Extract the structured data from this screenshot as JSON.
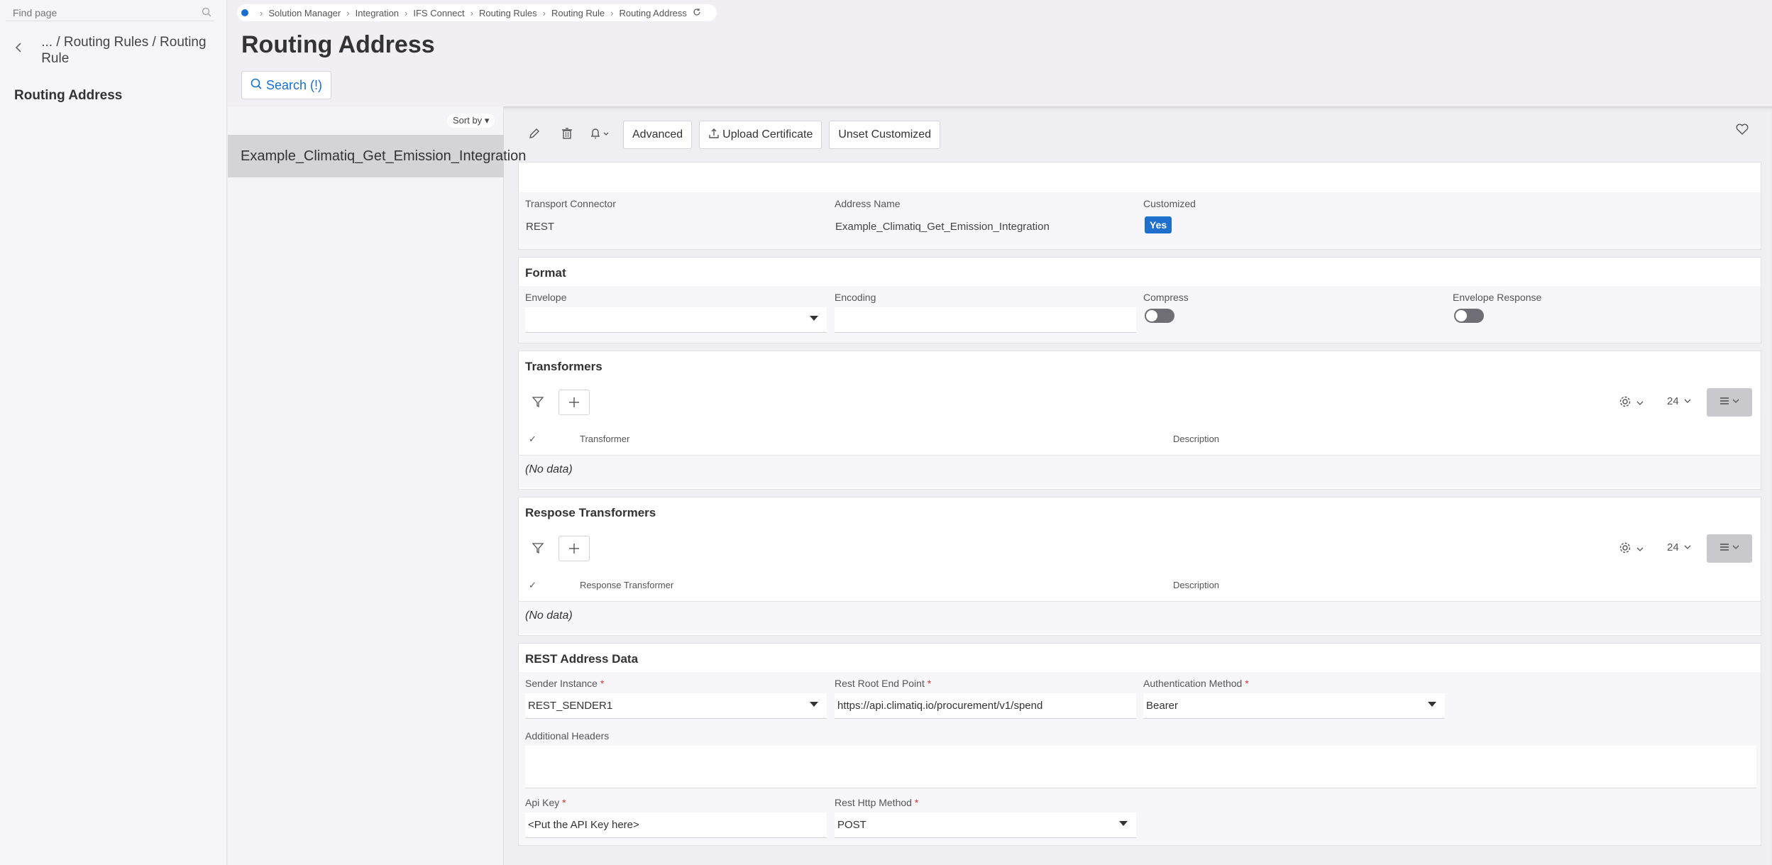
{
  "nav": {
    "find_placeholder": "Find page",
    "back_label": "... / Routing Rules / Routing Rule",
    "current": "Routing Address"
  },
  "breadcrumb": [
    "Solution Manager",
    "Integration",
    "IFS Connect",
    "Routing Rules",
    "Routing Rule",
    "Routing Address"
  ],
  "page": {
    "title": "Routing Address",
    "search_label": "Search (!)"
  },
  "list": {
    "sort_label": "Sort by",
    "items": [
      "Example_Climatiq_Get_Emission_Integration"
    ]
  },
  "toolbar": {
    "advanced": "Advanced",
    "upload_certificate": "Upload Certificate",
    "unset_customized": "Unset Customized"
  },
  "header_card": {
    "transport_connector_label": "Transport Connector",
    "transport_connector_value": "REST",
    "address_name_label": "Address Name",
    "address_name_value": "Example_Climatiq_Get_Emission_Integration",
    "customized_label": "Customized",
    "customized_value": "Yes"
  },
  "format": {
    "title": "Format",
    "envelope_label": "Envelope",
    "envelope_value": "",
    "encoding_label": "Encoding",
    "encoding_value": "",
    "compress_label": "Compress",
    "compress_on": false,
    "envelope_response_label": "Envelope Response",
    "envelope_response_on": false
  },
  "transformers": {
    "title": "Transformers",
    "page_size": "24",
    "col_transformer": "Transformer",
    "col_description": "Description",
    "empty": "(No data)"
  },
  "response_transformers": {
    "title": "Respose Transformers",
    "page_size": "24",
    "col_transformer": "Response Transformer",
    "col_description": "Description",
    "empty": "(No data)"
  },
  "rest": {
    "title": "REST Address Data",
    "sender_instance_label": "Sender Instance",
    "sender_instance_value": "REST_SENDER1",
    "root_endpoint_label": "Rest Root End Point",
    "root_endpoint_value": "https://api.climatiq.io/procurement/v1/spend",
    "auth_method_label": "Authentication Method",
    "auth_method_value": "Bearer",
    "additional_headers_label": "Additional Headers",
    "additional_headers_value": "",
    "api_key_label": "Api Key",
    "api_key_value": "<Put the API Key here>",
    "http_method_label": "Rest Http Method",
    "http_method_value": "POST",
    "required_mark": "*"
  },
  "colors": {
    "accent": "#1f6fcd",
    "required": "#d93636"
  }
}
